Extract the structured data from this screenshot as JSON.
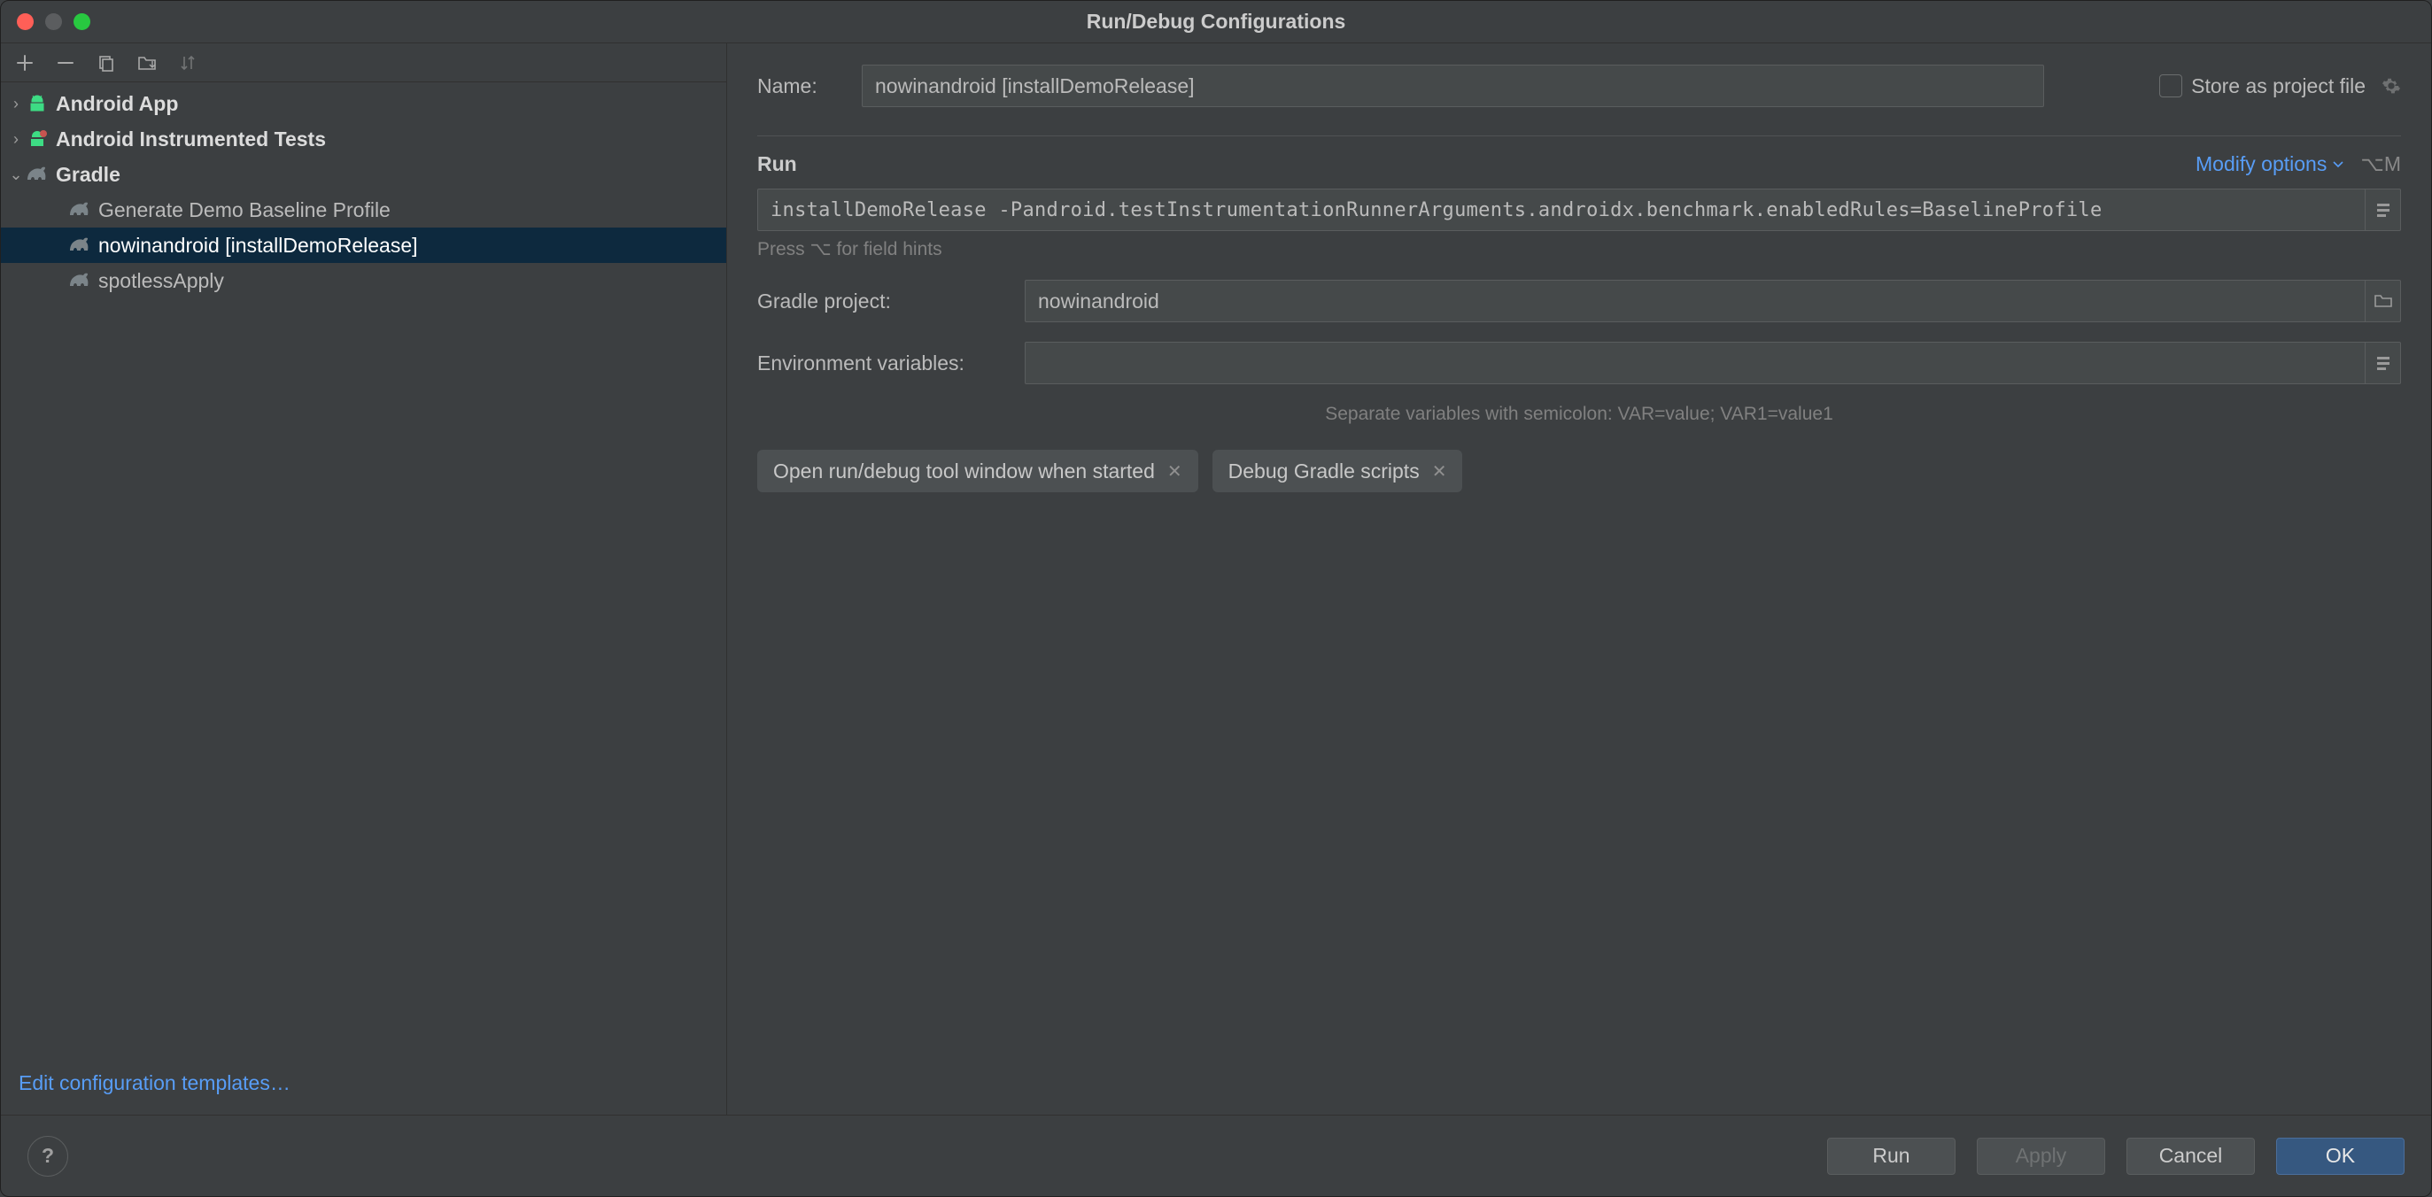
{
  "title": "Run/Debug Configurations",
  "toolbar": {
    "add": "+",
    "remove": "−"
  },
  "tree": {
    "items": [
      {
        "label": "Android App",
        "kind": "android",
        "expanded": false,
        "depth": 0,
        "bold": true
      },
      {
        "label": "Android Instrumented Tests",
        "kind": "android-test",
        "expanded": false,
        "depth": 0,
        "bold": true
      },
      {
        "label": "Gradle",
        "kind": "gradle-group",
        "expanded": true,
        "depth": 0,
        "bold": true
      },
      {
        "label": "Generate Demo Baseline Profile",
        "kind": "gradle",
        "depth": 1
      },
      {
        "label": "nowinandroid [installDemoRelease]",
        "kind": "gradle",
        "depth": 1,
        "selected": true
      },
      {
        "label": "spotlessApply",
        "kind": "gradle",
        "depth": 1
      }
    ]
  },
  "edit_templates": "Edit configuration templates…",
  "form": {
    "name_label": "Name:",
    "name_value": "nowinandroid [installDemoRelease]",
    "store_label": "Store as project file",
    "section": "Run",
    "modify": "Modify options",
    "modify_shortcut": "⌥M",
    "run_args": "installDemoRelease -Pandroid.testInstrumentationRunnerArguments.androidx.benchmark.enabledRules=BaselineProfile",
    "hint": "Press ⌥ for field hints",
    "gradle_label": "Gradle project:",
    "gradle_value": "nowinandroid",
    "env_label": "Environment variables:",
    "env_value": "",
    "env_hint": "Separate variables with semicolon: VAR=value; VAR1=value1",
    "chips": [
      "Open run/debug tool window when started",
      "Debug Gradle scripts"
    ]
  },
  "footer": {
    "run": "Run",
    "apply": "Apply",
    "cancel": "Cancel",
    "ok": "OK"
  }
}
